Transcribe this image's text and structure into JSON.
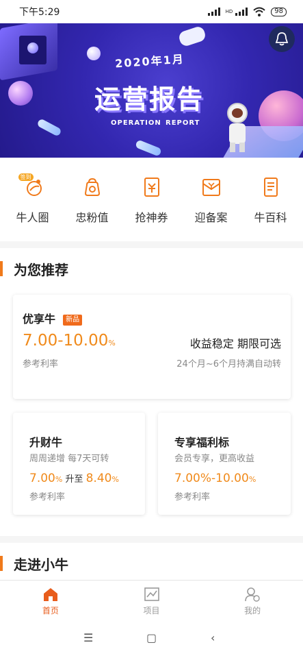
{
  "status_bar": {
    "time": "下午5:29",
    "battery": "98",
    "network": "HD"
  },
  "banner": {
    "year": "2020年1月",
    "title": "运营报告",
    "subtitle_a": "OPERATION",
    "subtitle_b": "REPORT"
  },
  "quick_entries": [
    {
      "label": "牛人圈",
      "icon": "niurenquan-icon",
      "tag": "签到"
    },
    {
      "label": "忠粉值",
      "icon": "loyalty-bag-icon"
    },
    {
      "label": "抢神券",
      "icon": "coupon-icon"
    },
    {
      "label": "迎备案",
      "icon": "filing-icon"
    },
    {
      "label": "牛百科",
      "icon": "encyclopedia-icon"
    }
  ],
  "recommend": {
    "title": "为您推荐",
    "featured": {
      "name": "优享牛",
      "badge": "新品",
      "rate": "7.00-10.00",
      "rate_unit": "%",
      "rate_label": "参考利率",
      "desc": "收益稳定 期限可选",
      "term": "24个月~6个月持满自动转"
    },
    "left": {
      "name": "升财牛",
      "desc": "周周递增 每7天可转",
      "rate_from": "7.00",
      "rate_unit": "%",
      "rate_mid": "升至",
      "rate_to": "8.40",
      "rate_label": "参考利率"
    },
    "right": {
      "name": "专享福利标",
      "desc": "会员专享，更高收益",
      "rate": "7.00%-10.00",
      "rate_unit": "%",
      "rate_label": "参考利率"
    }
  },
  "section2": {
    "title": "走进小牛"
  },
  "tabbar": {
    "tabs": [
      {
        "label": "首页",
        "icon": "home-icon",
        "active": true
      },
      {
        "label": "项目",
        "icon": "chart-icon",
        "active": false
      },
      {
        "label": "我的",
        "icon": "profile-icon",
        "active": false
      }
    ]
  },
  "colors": {
    "accent": "#f08a1b",
    "brand": "#e85d1c",
    "banner_bg": "#3327b0"
  }
}
